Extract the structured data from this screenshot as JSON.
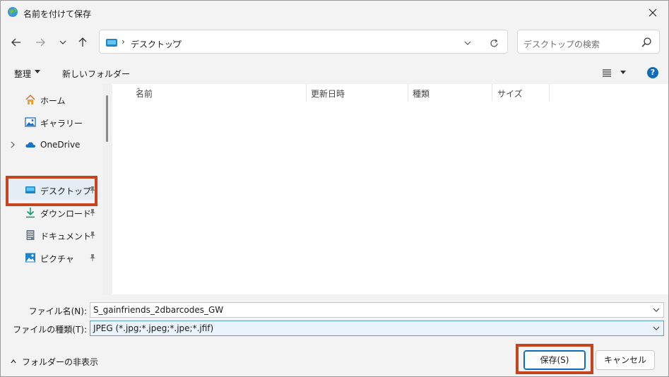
{
  "window": {
    "title": "名前を付けて保存"
  },
  "nav": {
    "address_current": "デスクトップ",
    "address_sep": "›",
    "search_placeholder": "デスクトップの検索"
  },
  "toolbar": {
    "organize_label": "整理",
    "new_folder_label": "新しいフォルダー",
    "help_label": "?"
  },
  "sidebar": {
    "items": [
      {
        "label": "ホーム",
        "icon": "home-icon"
      },
      {
        "label": "ギャラリー",
        "icon": "gallery-icon"
      },
      {
        "label": "OneDrive",
        "icon": "cloud-icon"
      },
      {
        "label": "デスクトップ",
        "icon": "desktop-icon",
        "selected": true
      },
      {
        "label": "ダウンロード",
        "icon": "download-icon"
      },
      {
        "label": "ドキュメント",
        "icon": "document-icon"
      },
      {
        "label": "ピクチャ",
        "icon": "picture-icon"
      }
    ]
  },
  "columns": {
    "name": "名前",
    "modified": "更新日時",
    "type": "種類",
    "size": "サイズ"
  },
  "form": {
    "filename_label": "ファイル名(N):",
    "filename_value": "S_gainfriends_2dbarcodes_GW",
    "filetype_label": "ファイルの種類(T):",
    "filetype_value": "JPEG (*.jpg;*.jpeg;*.jpe;*.jfif)"
  },
  "footer": {
    "hide_folders_label": "フォルダーの非表示",
    "save_label": "保存(S)",
    "cancel_label": "キャンセル"
  },
  "colors": {
    "accent": "#0f6cbd",
    "highlight": "#c7441e"
  }
}
